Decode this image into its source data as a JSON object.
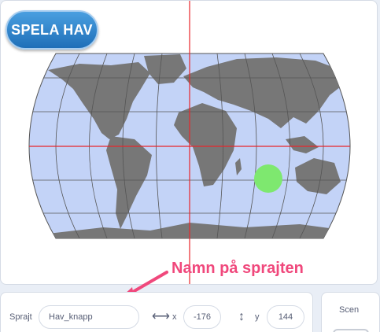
{
  "stage": {
    "button_label": "SPELA HAV",
    "map_colors": {
      "ocean": "#c3d3f7",
      "land": "#777777",
      "grid": "#555555",
      "axis": "#e8262b",
      "target": "#7ee86f"
    }
  },
  "annotation": {
    "text": "Namn på sprajten",
    "color": "#f0487c"
  },
  "sprite_info": {
    "sprite_label": "Sprajt",
    "sprite_name": "Hav_knapp",
    "x_label": "x",
    "x_value": "-176",
    "y_label": "y",
    "y_value": "144",
    "x_icon": "horizontal-arrows-icon",
    "y_icon": "vertical-arrows-icon"
  },
  "scene_panel": {
    "title": "Scen"
  }
}
